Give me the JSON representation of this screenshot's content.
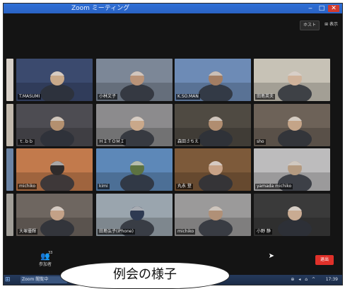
{
  "window": {
    "title": "Zoom ミーティング",
    "min_label": "‒",
    "max_label": "□",
    "close_label": "✕"
  },
  "topbar": {
    "pill_label": "ホスト",
    "view_label": "⊞ 表示"
  },
  "participants": [
    {
      "name": "T.MASUMI",
      "bg": "#3b4a6e",
      "person": "#c8a98a"
    },
    {
      "name": "小林文子",
      "bg": "#7c8797",
      "person": "#b99378"
    },
    {
      "name": "K.SO.MAN",
      "bg": "#6d8bb6",
      "person": "#a27d63"
    },
    {
      "name": "田島英夫",
      "bg": "#c7c2b6",
      "person": "#d0b29a"
    },
    {
      "name": "ｔ.ｂｂ",
      "bg": "#4d4c52",
      "person": "#b3906f"
    },
    {
      "name": "ＨＩＴＯＭＩ",
      "bg": "#8c8b8d",
      "person": "#c9a88a"
    },
    {
      "name": "森田さちえ",
      "bg": "#4f4a42",
      "person": "#b08d70"
    },
    {
      "name": "sho",
      "bg": "#6d6258",
      "person": "#c4a488"
    },
    {
      "name": "michiko",
      "bg": "#c27a4c",
      "person": "#2f2b2b"
    },
    {
      "name": "kimi",
      "bg": "#5d88b8",
      "person": "#5c7241"
    },
    {
      "name": "丸永 登",
      "bg": "#7d5a3a",
      "person": "#c7a286"
    },
    {
      "name": "yamada michiko",
      "bg": "#bdbcbd",
      "person": "#b49a80"
    },
    {
      "name": "大塚優輝",
      "bg": "#6e6660",
      "person": "#c3a187"
    },
    {
      "name": "田島弘子(iPhone)",
      "bg": "#9aa5ae",
      "person": "#2e3a52"
    },
    {
      "name": "michiko",
      "bg": "#9b9a9a",
      "person": "#b09077"
    },
    {
      "name": "小野 静",
      "bg": "#3a3a3a",
      "person": "#c9ab92"
    }
  ],
  "toolbar": {
    "participants_icon": "participants-icon",
    "participants_count": "33",
    "participants_label": "参加者",
    "end_label": "退出"
  },
  "taskbar": {
    "start_icon": "windows-start-icon",
    "app_label": "Zoom 閲覧中",
    "tray_label": "⊕ ◂ ⌂ ^",
    "time": "17:39"
  },
  "caption": "例会の様子"
}
